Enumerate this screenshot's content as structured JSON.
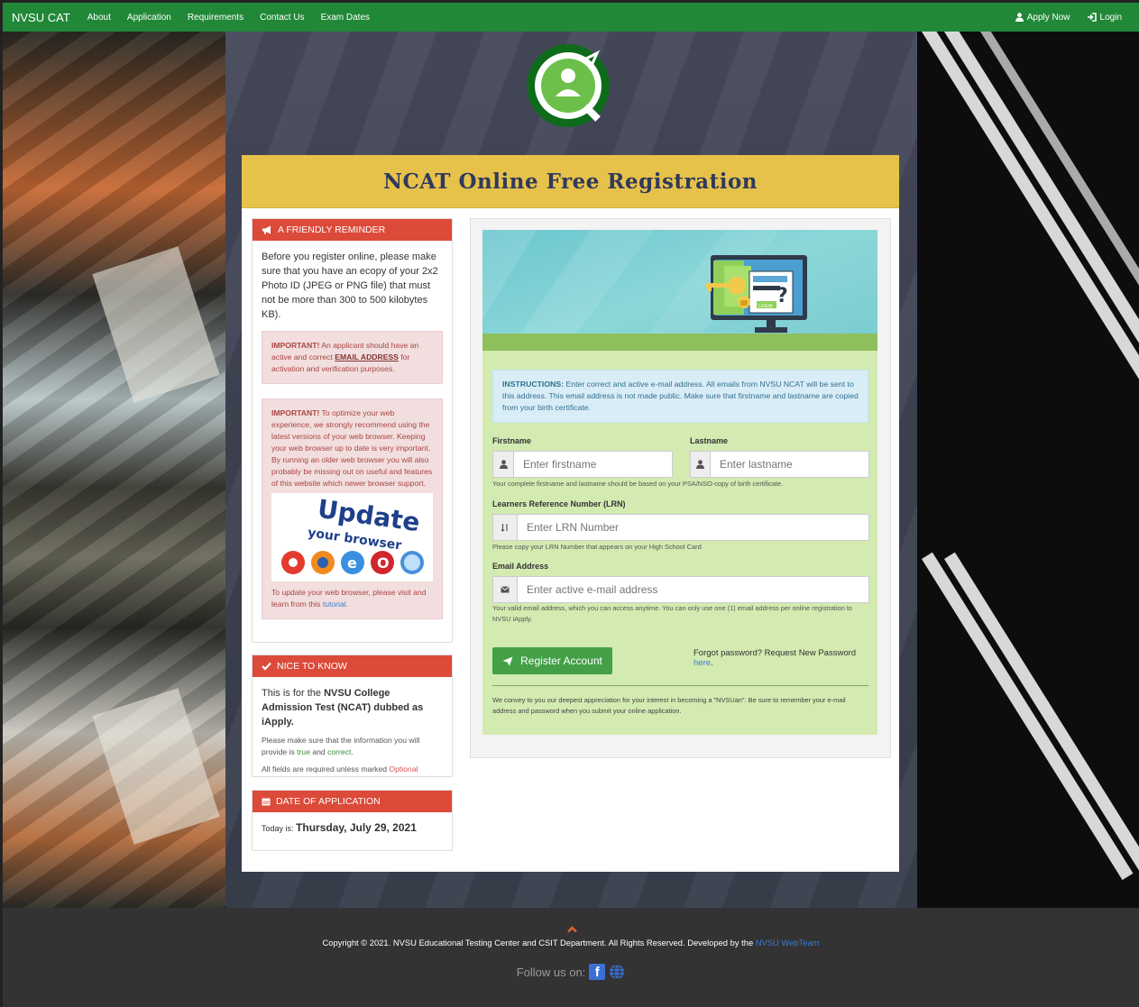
{
  "navbar": {
    "brand": "NVSU CAT",
    "links": [
      "About",
      "Application",
      "Requirements",
      "Contact Us",
      "Exam Dates"
    ],
    "apply_now": "Apply Now",
    "login": "Login"
  },
  "colors": {
    "navbar_bg": "#218838",
    "header_bg": "#e7c24a",
    "panel_head": "#dc4a3a",
    "form_bg": "#d3eab1",
    "button": "#43a047",
    "footer_bg": "#333333"
  },
  "card": {
    "title": "NCAT Online Free Registration"
  },
  "reminder": {
    "heading": "A FRIENDLY REMINDER",
    "text": "Before you register online, please make sure that you have an ecopy of your 2x2 Photo ID (JPEG or PNG file) that must not be more than 300 to 500 kilobytes KB).",
    "alert1_strong": "IMPORTANT!",
    "alert1_pre": "An applicant should have an active and correct",
    "alert1_link": "EMAIL ADDRESS",
    "alert1_post": "for activation and verification purposes.",
    "alert2_strong": "IMPORTANT!",
    "alert2_text": "To optimize your web experience, we strongly recommend using the latest versions of your web browser. Keeping your web browser up to date is very important. By running an older web browser you will also probably be missing out on useful and features of this website which newer browser support.",
    "update_word": "Update",
    "update_sub": "your browser",
    "alert2_footer_pre": "To update your web browser, please visit and learn from this",
    "alert2_footer_link": "tutorial",
    "alert2_footer_post": "."
  },
  "nice": {
    "heading": "NICE TO KNOW",
    "line1_pre": "This is for the ",
    "line1_bold": "NVSU College Admission Test (NCAT) dubbed as iApply.",
    "line2_pre": "Please make sure that the information you will provide is ",
    "line2_green1": "true",
    "line2_and": " and ",
    "line2_green2": "correct",
    "line2_post": ".",
    "line3_pre": "All fields are required unless marked ",
    "line3_red": "Optional"
  },
  "date_panel": {
    "heading": "DATE OF APPLICATION",
    "prefix": "Today is: ",
    "date": "Thursday, July 29, 2021"
  },
  "form": {
    "instructions_strong": "INSTRUCTIONS:",
    "instructions_text": "Enter correct and active e-mail address. All emails from NVSU NCAT will be sent to this address. This email address is not made public. Make sure that firstname and lastname are copied from your birth certificate.",
    "firstname_label": "Firstname",
    "firstname_placeholder": "Enter firstname",
    "lastname_label": "Lastname",
    "lastname_placeholder": "Enter lastname",
    "name_help": "Your complete firstname and lastname should be based on your PSA/NSO-copy of birth certificate.",
    "lrn_label": "Learners Reference Number (LRN)",
    "lrn_placeholder": "Enter LRN Number",
    "lrn_help": "Please copy your LRN Number that appears on your High School Card",
    "email_label": "Email Address",
    "email_placeholder": "Enter active e-mail address",
    "email_help": "Your valid email address, which you can access anytime. You can only use one (1) email address per online registration to NVSU iApply.",
    "register_button": "Register Account",
    "forgot_pre": "Forgot password? Request New Password ",
    "forgot_link": "here",
    "forgot_post": ".",
    "appreciation": "We convey to you our deepest appreciation for your interest in becoming a \"NVSUan\". Be sure to remember your e-mail address and password when you submit your online application.",
    "hero_login_label": "LOGIN"
  },
  "footer": {
    "copyright_pre": "Copyright © 2021. NVSU Educational Testing Center and CSIT Department. All Rights Reserved. Developed by the ",
    "copyright_link": "NVSU WebTeam",
    "follow_label": "Follow us on:"
  }
}
